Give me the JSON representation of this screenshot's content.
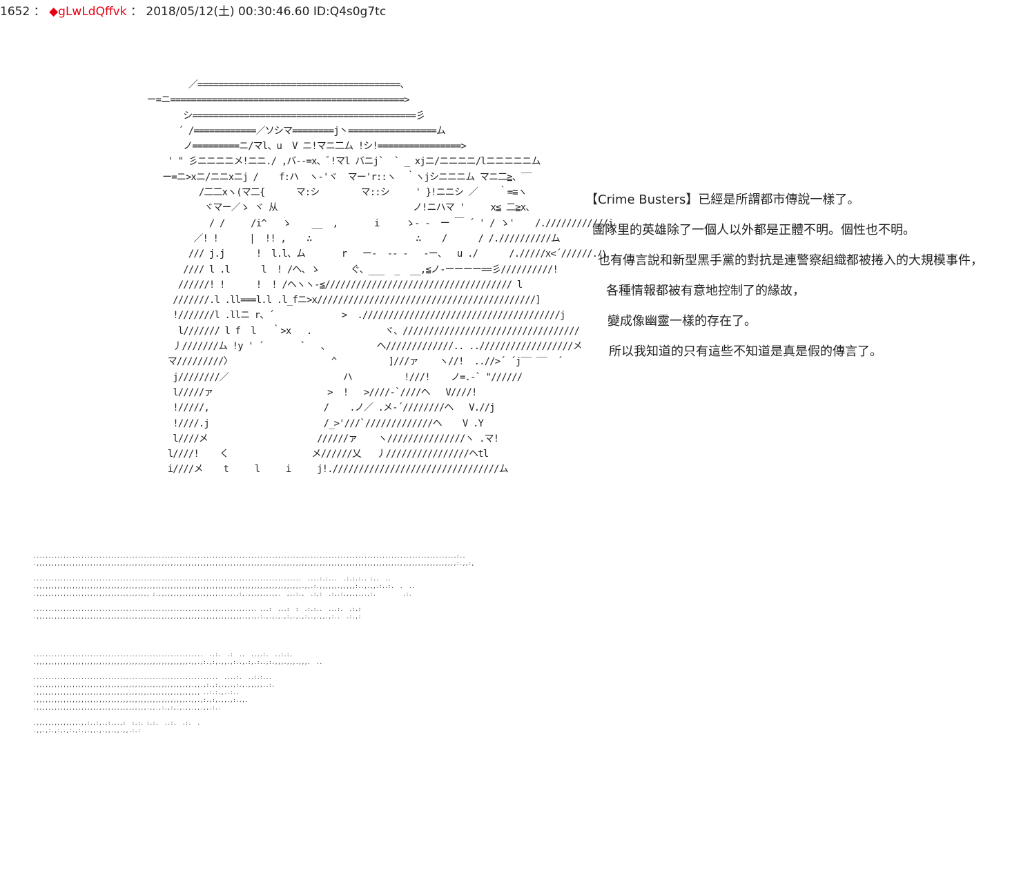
{
  "post": {
    "number": "1652",
    "separator": "：",
    "trip_mark": "◆",
    "trip": "gLwLdQffvk",
    "separator2": "：",
    "datetime": "2018/05/12(土) 00:30:46.60",
    "id": "ID:Q4s0g7tc"
  },
  "ascii_art": "           ／=======================================、\n   ー=ニ=============================================>\n          シ===========================================彡\n         ´ /============／ソシマ========j丶=================ム\n          ノ=========ニ/マl、u  V ニ!マニ二ム !シ!================>\n       ' \" 彡ニニニニメ!ニニ./ ,バ--=x、ﾞ!マl バニj`  ` _ xjニ/ニニニニ/lニニニニニム\n      ー=ニ>xニ/ニニxニj /    f:ハ  ヽ-'ヾ  マー'r::ヽ  ｀ヽjシニニニム マニ二≧、‾‾\n             /二二xヽ(マ二{      マ:シ        マ::シ     ' }!ニニシ ／    ｀=≡ヽ\n              ヾマー／ゝ ヾ 从                          ノ!ニハマ '     x≦ 二≧x、\n               / /     /i^   ゝ    __  ,       i     ゝ- -  ー ￣ ´ ' / ゝ'    /.////////////j\n            ／! !      |  !! ,    ∴                    ∴    /      / /.//////////ム\n           /// j.j      !  l.l、ム       r   ー-  -- -   -ー、  u ./      /./////x<´//////.ハ\n          //// l .l      l  ! /ヘ、ゝ      ぐ、___  _  __,≦ノ-ーーーー==彡//////////!\n         //////! !      !  ! /ヘヽヽ-≦//////////////////////////////////// l\n        ///////.l .ll===l.l .l_fニ>x//////////////////////////////////////////]\n        !///////l .llニ r、´             >  .//////////////////////////////////////j\n         l/////// l f  l   ｀>x   .              ヾ、//////////////////////////////////\n        丿///////ム !y ' ´       `   、         ヘ/////////////.. ..//////////////////メ\n       マ/////////〉                   ^          ]///ァ    ヽ//!  ..//>´ ´j‾‾ ‾‾  ´\n        j////////／                      ハ          !///!    ノ=.-` \"//////\n        l/////ァ                      >  !   >////-`////ヘ   V////!\n        !/////,                      /    .ノ／ .メ-´////////ヘ   V.//j\n        !////.j                      /_>'///`/////////////ヘ    V .Y\n        l////メ                     //////ァ    ヽ///////////////ヽ .マ!\n       l////!    く                メ//////乂   丿////////////////ヘtl\n       i////メ    t     l     i     j!.////////////////////////////////ム",
  "narration": [
    "【Crime Busters】已經是所謂都市傳說一樣了。",
    "團隊里的英雄除了一個人以外都是正體不明。個性也不明。",
    "也有傳言說和新型黑手黨的對抗是連警察組織都被捲入的大規模事件，",
    "各種情報都被有意地控制了的緣故，",
    "變成像幽靈一樣的存在了。",
    "所以我知道的只有這些不知道是真是假的傳言了。"
  ],
  "dots_art": "..............................................................................................................................................:..\n.,,,,,,,,,,,,,,,,,,,,,,,,,,,,,,,,,,,,,,,,,,,,,,,,,,,,,,,,,,,,,,,,,,,,,,,,,,,,,,,,,,,,,,,,,,,,,,,,,,,,,,,,,,,,,,,,,,,,,,,,,,,,,,,,,,,,,,,,,,,,,:.,,:,\n\n..........................................................................................  ....:.:...  .:.:.:.. :..  ..\n.,,,,,,,,,,,,,,,,,,,,,,,,,,,,,,,,,,,,,,,,,,,,,,,,,,,,,,,,,,,,,,,,,,,,,,,,,,,,,,,,,,,,,,,,,.,,.:.,,,,,,.,,,,,:..,.,,.:..:.  .  ..\n.,,,,,,,,,,,,,,,,,,,,,,,,,,,,,,,,,,,,,, ;.,,,,,,,,,,,,,,,,,,,,.,.,,.,:,.,,,,,,,.,,.  ,,.:.,  .:,:  .:,.:,,,,,.,.,:.         .:.\n\n........................................................................... ...:  ...:  :  .:.:..  ...:.  .:.:\n.,,,,,,,,,,,,,,,,,,,,,,,,,,,,,,,,,,,,,,,,,,,,,,,,,,,,,,,,,,,,,,,,,,,,,.,,.,.:.,.,.,.,:,.,.,:,.,.,,.,:..  .:.,:\n\n\n\n\n.........................................................  ..:.  .:  ..  ....:.  ..:.:.\n.,,,,,,,,,,,,,,,,,,,,,,,,,,,,,,,,,,,,,,,,,,,,,,,,,,,.,,.,:.,:,.,,.,:..,.:,.:..,:.,,,.,,,.,,,.  ..\n\n..............................................................  ....:.  ..:.:...\n.,,,,,,,,,,,,,,,,,,,,,,,,,,,,,,,,,,,,,,,,,,,,,,,,,,,,.,,.,:.,:,.,,.,:.,.,,,,,..:.\n.,,,,,,,,,,,,,,,,,,,,,,,,,,,,,,,,,,,,,,,,,,,,,,,,,,,,,,, ..:.:.,..:..\n.,,,,,,,,,,,,,,,,,,,,,,,,,,,,,,,,,,,,,,,,,,,,,,,,,,,.,,.,:.,:,.,,.,:..,.\n.,,,,,,,,,,,,,,,,,,,,,,,,,,,,,,,,,,,,,.,,.,:.,:,.,.,,.,,.,,.:..\n\n.,,,,,,,,,,,,,,.,,:.,:,.,:.,.,:  :.:. :.:.  ..:.  .:.  .\n.,,.,:.,:,.,:.,:.,.,,.,.,,.,,.,,.:.:"
}
